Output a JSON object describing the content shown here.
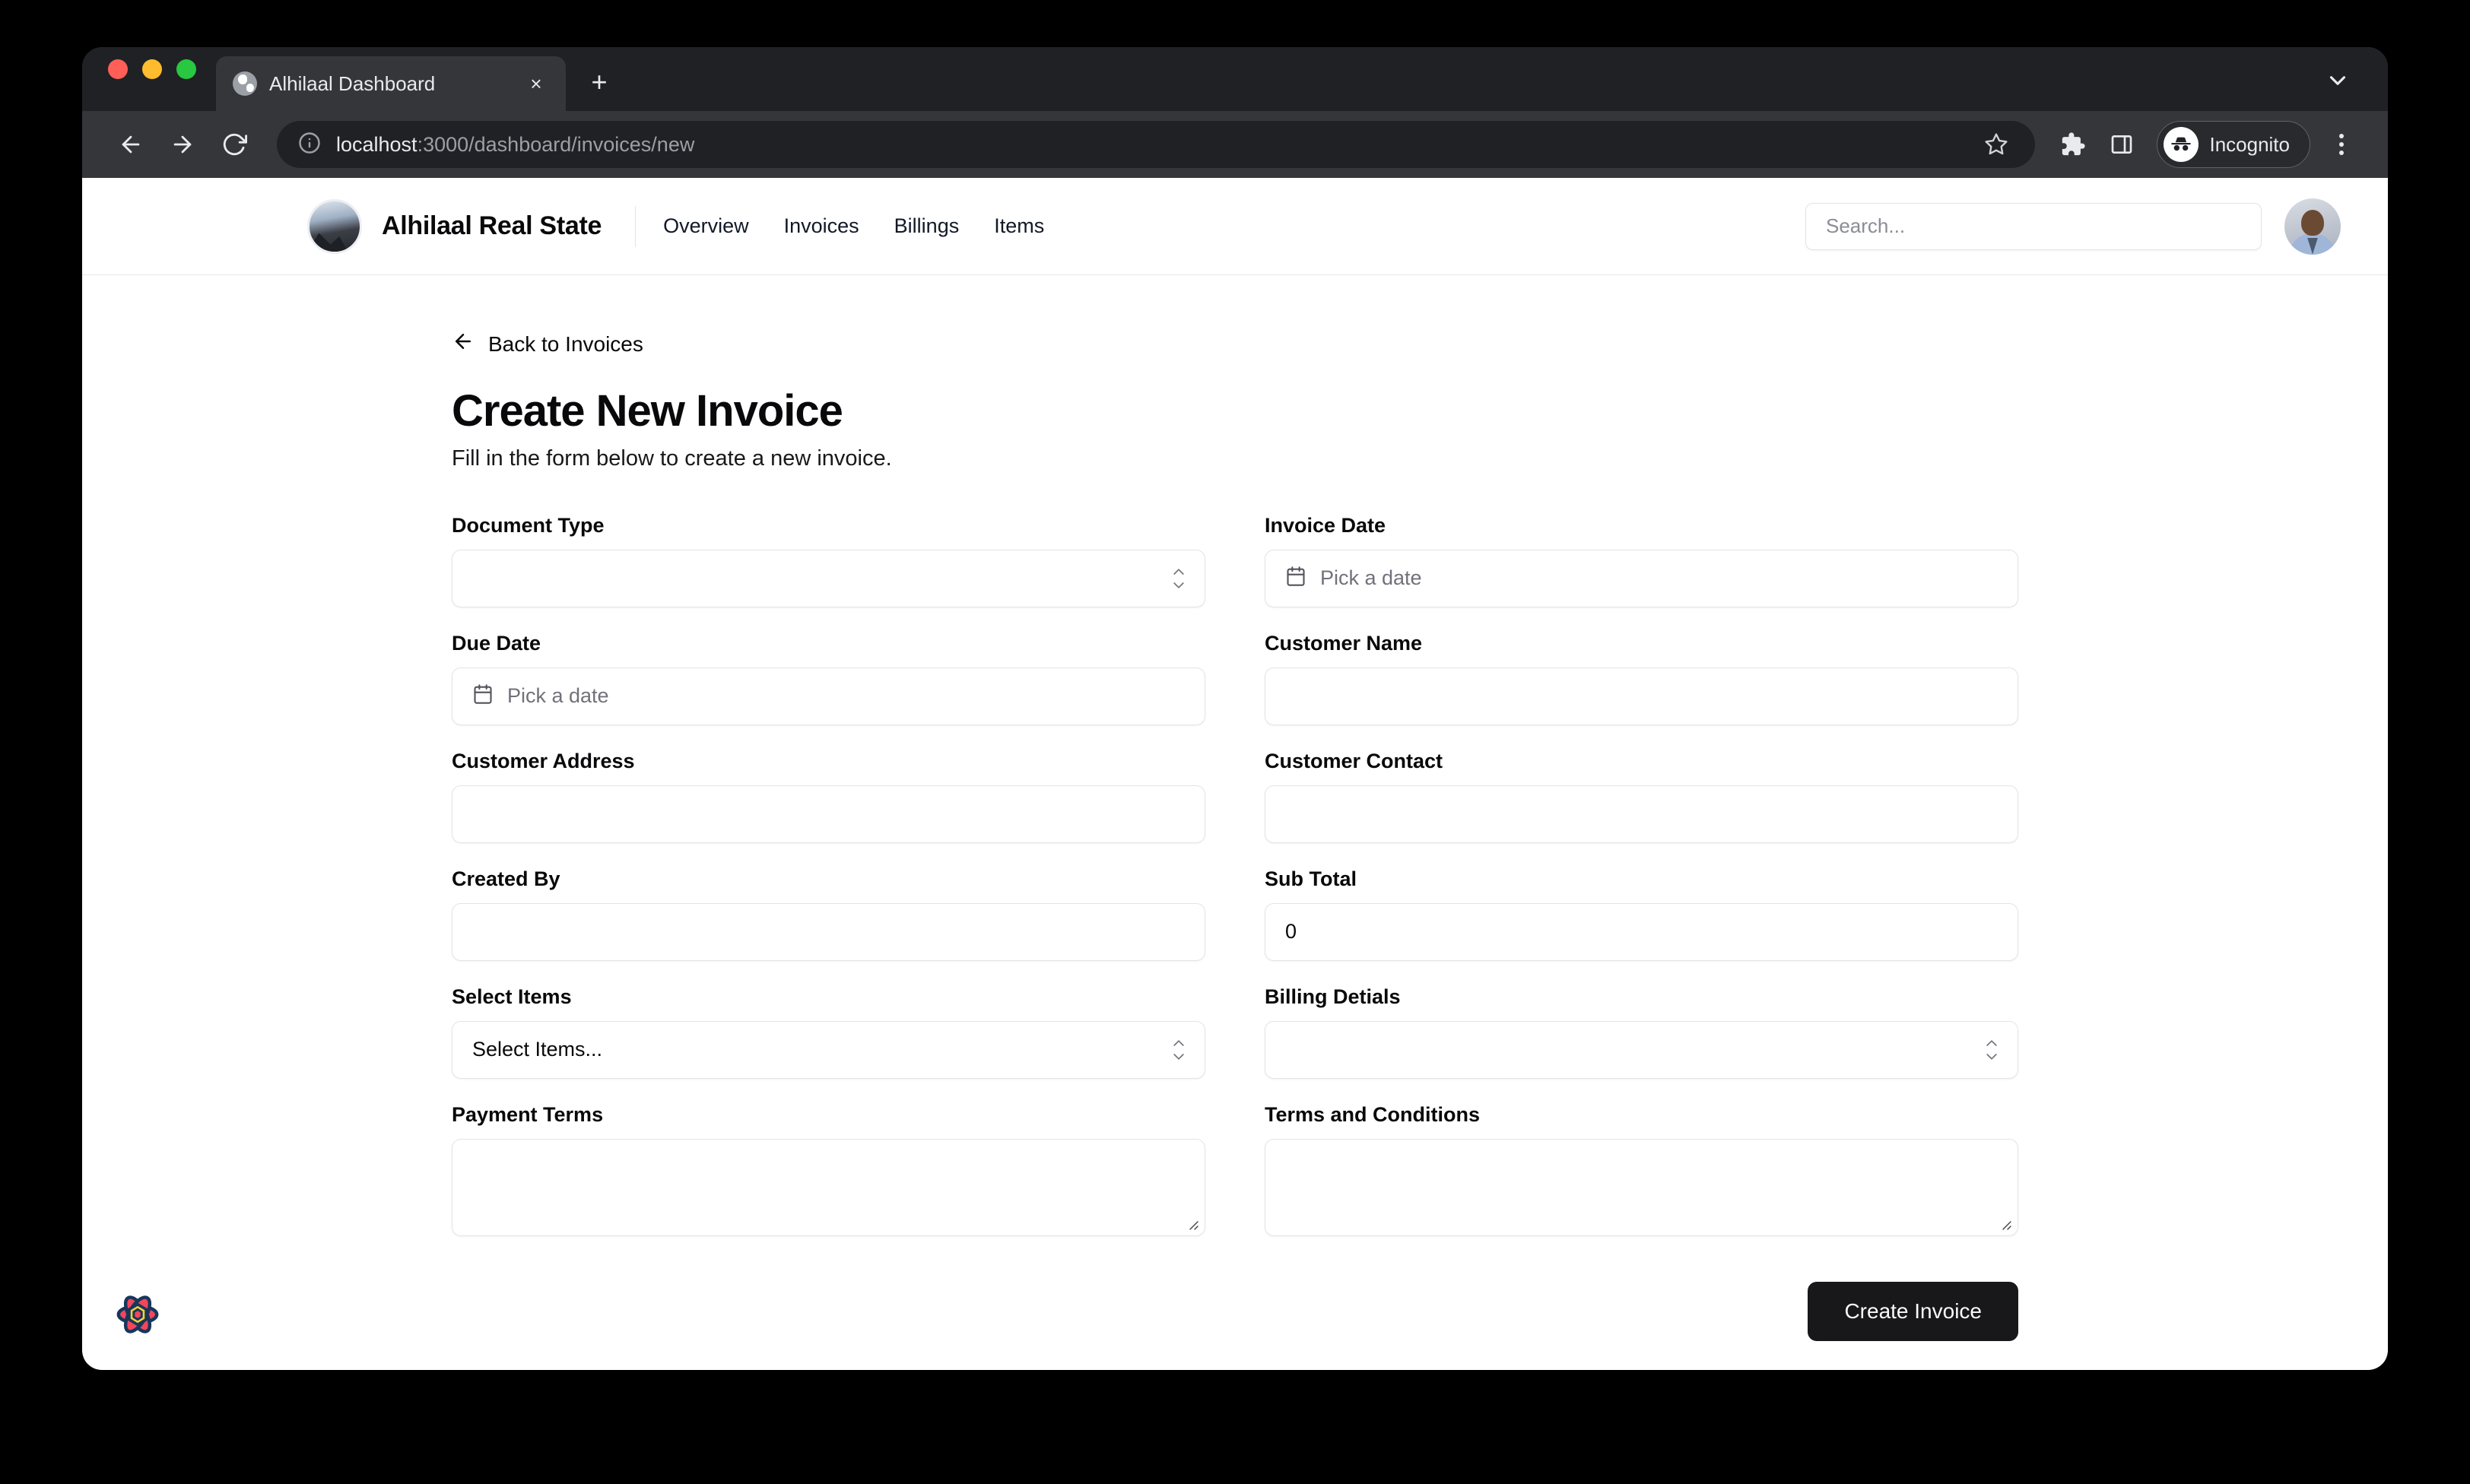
{
  "browser": {
    "tab_title": "Alhilaal Dashboard",
    "url_host": "localhost",
    "url_path": ":3000/dashboard/invoices/new",
    "profile_label": "Incognito",
    "new_tab_label": "+",
    "close_tab_label": "×"
  },
  "app_header": {
    "brand_name": "Alhilaal Real State",
    "nav": [
      {
        "label": "Overview"
      },
      {
        "label": "Invoices"
      },
      {
        "label": "Billings"
      },
      {
        "label": "Items"
      }
    ],
    "search_placeholder": "Search..."
  },
  "page": {
    "back_link": "Back to Invoices",
    "title": "Create New Invoice",
    "subtitle": "Fill in the form below to create a new invoice."
  },
  "form": {
    "fields": [
      {
        "label": "Document Type",
        "type": "select",
        "value": ""
      },
      {
        "label": "Invoice Date",
        "type": "date",
        "placeholder": "Pick a date"
      },
      {
        "label": "Due Date",
        "type": "date",
        "placeholder": "Pick a date"
      },
      {
        "label": "Customer Name",
        "type": "text",
        "value": ""
      },
      {
        "label": "Customer Address",
        "type": "text",
        "value": ""
      },
      {
        "label": "Customer Contact",
        "type": "text",
        "value": ""
      },
      {
        "label": "Created By",
        "type": "text",
        "value": ""
      },
      {
        "label": "Sub Total",
        "type": "text",
        "value": "0"
      },
      {
        "label": "Select Items",
        "type": "select",
        "value": "Select Items..."
      },
      {
        "label": "Billing Detials",
        "type": "select",
        "value": ""
      },
      {
        "label": "Payment Terms",
        "type": "textarea",
        "value": ""
      },
      {
        "label": "Terms and Conditions",
        "type": "textarea",
        "value": ""
      }
    ],
    "submit_label": "Create Invoice"
  },
  "colors": {
    "primary_button": "#18181b",
    "border": "#e4e4e7",
    "browser_chrome": "#35363a",
    "badge_petal": "#f4465a",
    "badge_core": "#f6d32d",
    "badge_outline": "#17365c"
  }
}
